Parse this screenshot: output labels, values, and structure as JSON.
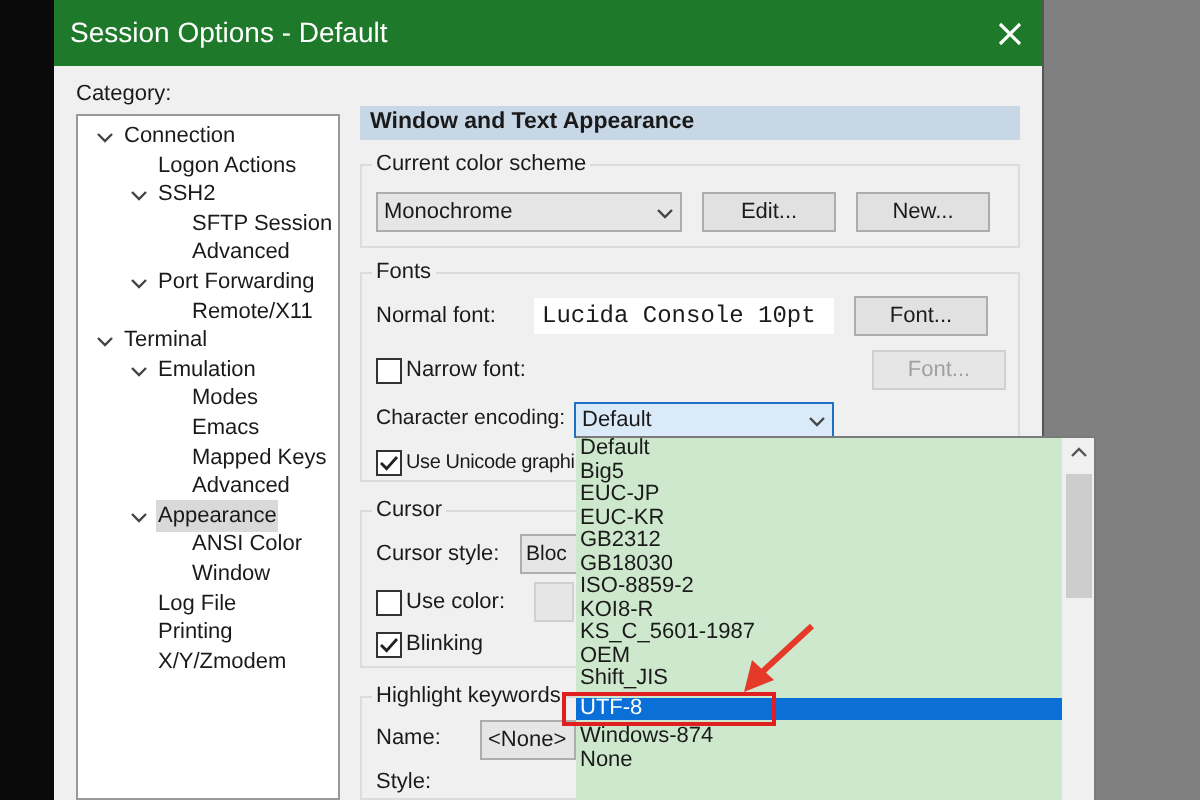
{
  "window": {
    "title": "Session Options - Default"
  },
  "category": {
    "label": "Category:",
    "tree": [
      {
        "label": "Connection",
        "expanded": true,
        "selected": false,
        "children": [
          {
            "label": "Logon Actions",
            "selected": false
          },
          {
            "label": "SSH2",
            "expanded": true,
            "selected": false,
            "children": [
              {
                "label": "SFTP Session",
                "selected": false
              },
              {
                "label": "Advanced",
                "selected": false
              }
            ]
          },
          {
            "label": "Port Forwarding",
            "expanded": true,
            "selected": false,
            "children": [
              {
                "label": "Remote/X11",
                "selected": false
              }
            ]
          }
        ]
      },
      {
        "label": "Terminal",
        "expanded": true,
        "selected": false,
        "children": [
          {
            "label": "Emulation",
            "expanded": true,
            "selected": false,
            "children": [
              {
                "label": "Modes",
                "selected": false
              },
              {
                "label": "Emacs",
                "selected": false
              },
              {
                "label": "Mapped Keys",
                "selected": false
              },
              {
                "label": "Advanced",
                "selected": false
              }
            ]
          },
          {
            "label": "Appearance",
            "expanded": true,
            "selected": true,
            "children": [
              {
                "label": "ANSI Color",
                "selected": false
              },
              {
                "label": "Window",
                "selected": false
              }
            ]
          },
          {
            "label": "Log File",
            "selected": false
          },
          {
            "label": "Printing",
            "selected": false
          },
          {
            "label": "X/Y/Zmodem",
            "selected": false
          }
        ]
      }
    ]
  },
  "panel": {
    "header": "Window and Text Appearance",
    "color_scheme": {
      "title": "Current color scheme",
      "value": "Monochrome",
      "buttons": [
        "Edit...",
        "New..."
      ]
    },
    "fonts": {
      "title": "Fonts",
      "normal_font_label": "Normal font:",
      "normal_font_value": "Lucida Console 10pt",
      "font_button": {
        "label": "Font...",
        "disabled": false
      },
      "narrow_font": {
        "label": "Narrow font:",
        "checked": false
      },
      "narrow_font_button": {
        "label": "Font...",
        "disabled": true
      },
      "encoding_label": "Character encoding:",
      "encoding_value": "Default",
      "unicode": {
        "label": "Use Unicode graphi",
        "checked": true
      }
    },
    "cursor": {
      "title": "Cursor",
      "style_label": "Cursor style:",
      "style_value": "Bloc",
      "use_color": {
        "label": "Use color:",
        "checked": false
      },
      "blinking": {
        "label": "Blinking",
        "checked": true
      }
    },
    "highlight": {
      "title": "Highlight keywords",
      "name_label": "Name:",
      "name_value": "<None>",
      "style_label": "Style:"
    }
  },
  "encoding_list": {
    "items": [
      {
        "label": "Default",
        "selected": false
      },
      {
        "label": "Big5",
        "selected": false
      },
      {
        "label": "EUC-JP",
        "selected": false
      },
      {
        "label": "EUC-KR",
        "selected": false
      },
      {
        "label": "GB2312",
        "selected": false
      },
      {
        "label": "GB18030",
        "selected": false
      },
      {
        "label": "ISO-8859-2",
        "selected": false
      },
      {
        "label": "KOI8-R",
        "selected": false
      },
      {
        "label": "KS_C_5601-1987",
        "selected": false
      },
      {
        "label": "OEM",
        "selected": false
      },
      {
        "label": "Shift_JIS",
        "selected": false
      },
      {
        "label": "UTF-8",
        "selected": true
      },
      {
        "label": "Windows-874",
        "selected": false
      },
      {
        "label": "None",
        "selected": false
      }
    ]
  }
}
